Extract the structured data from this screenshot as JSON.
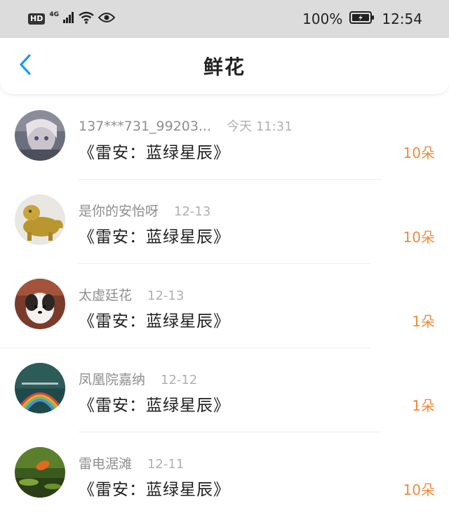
{
  "status_bar": {
    "hd": "HD",
    "network": "4G",
    "battery": "100%",
    "time": "12:54"
  },
  "header": {
    "title": "鲜花",
    "back_icon": "chevron-left-icon"
  },
  "colors": {
    "accent": "#1a9bf0",
    "count": "#f08a3e"
  },
  "items": [
    {
      "user": "137***731_99203...",
      "time": "今天 11:31",
      "book": "《雷安：蓝绿星辰》",
      "count": "10朵"
    },
    {
      "user": "是你的安怡呀",
      "time": "12-13",
      "book": "《雷安：蓝绿星辰》",
      "count": "10朵"
    },
    {
      "user": "太虚廷花",
      "time": "12-13",
      "book": "《雷安：蓝绿星辰》",
      "count": "1朵"
    },
    {
      "user": "凤凰院嘉纳",
      "time": "12-12",
      "book": "《雷安：蓝绿星辰》",
      "count": "1朵"
    },
    {
      "user": "雷电涺滩",
      "time": "12-11",
      "book": "《雷安：蓝绿星辰》",
      "count": "10朵"
    }
  ]
}
